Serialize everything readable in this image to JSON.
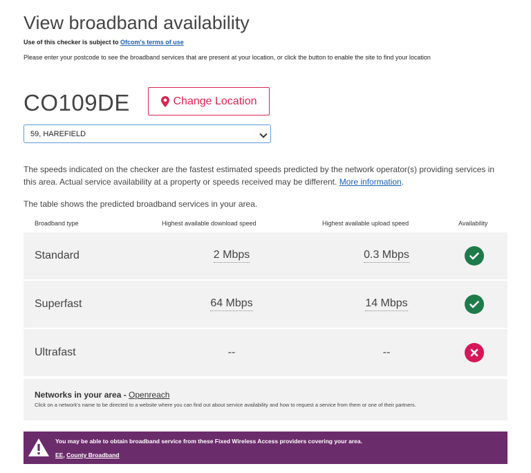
{
  "page": {
    "title": "View broadband availability",
    "subject_prefix": "Use of this checker is subject to ",
    "subject_link": "Ofcom's terms of use",
    "intro": "Please enter your postcode to see the broadband services that are present at your location, or click the button to enable the site to find your location"
  },
  "location": {
    "postcode": "CO109DE",
    "change_button": "Change Location",
    "address_selected": "59, HAREFIELD"
  },
  "disclaimer": {
    "text": "The speeds indicated on the checker are the fastest estimated speeds predicted by the network operator(s) providing services in this area. Actual service availability at a property or speeds received may be different. ",
    "link": "More information",
    "suffix": "."
  },
  "table": {
    "intro": "The table shows the predicted broadband services in your area.",
    "headers": {
      "type": "Broadband type",
      "download": "Highest available download speed",
      "upload": "Highest available upload speed",
      "availability": "Availability"
    },
    "rows": [
      {
        "type": "Standard",
        "download": "2 Mbps",
        "upload": "0.3 Mbps",
        "available": true
      },
      {
        "type": "Superfast",
        "download": "64 Mbps",
        "upload": "14 Mbps",
        "available": true
      },
      {
        "type": "Ultrafast",
        "download": "--",
        "upload": "--",
        "available": false
      }
    ]
  },
  "networks": {
    "label": "Networks in your area - ",
    "operator": "Openreach",
    "description": "Click on a network's name to be directed to a website where you can find out about service availability and how to request a service from them or one of their partners."
  },
  "fwa": {
    "message": "You may be able to obtain broadband service from these Fixed Wireless Access providers covering your area.",
    "provider_1": "EE",
    "separator": ", ",
    "provider_2": "County Broadband"
  },
  "colors": {
    "accent": "#d6264f",
    "available": "#1f7a4a",
    "unavailable": "#d6175a",
    "banner": "#6b2c6b",
    "link": "#1a5fb4"
  }
}
